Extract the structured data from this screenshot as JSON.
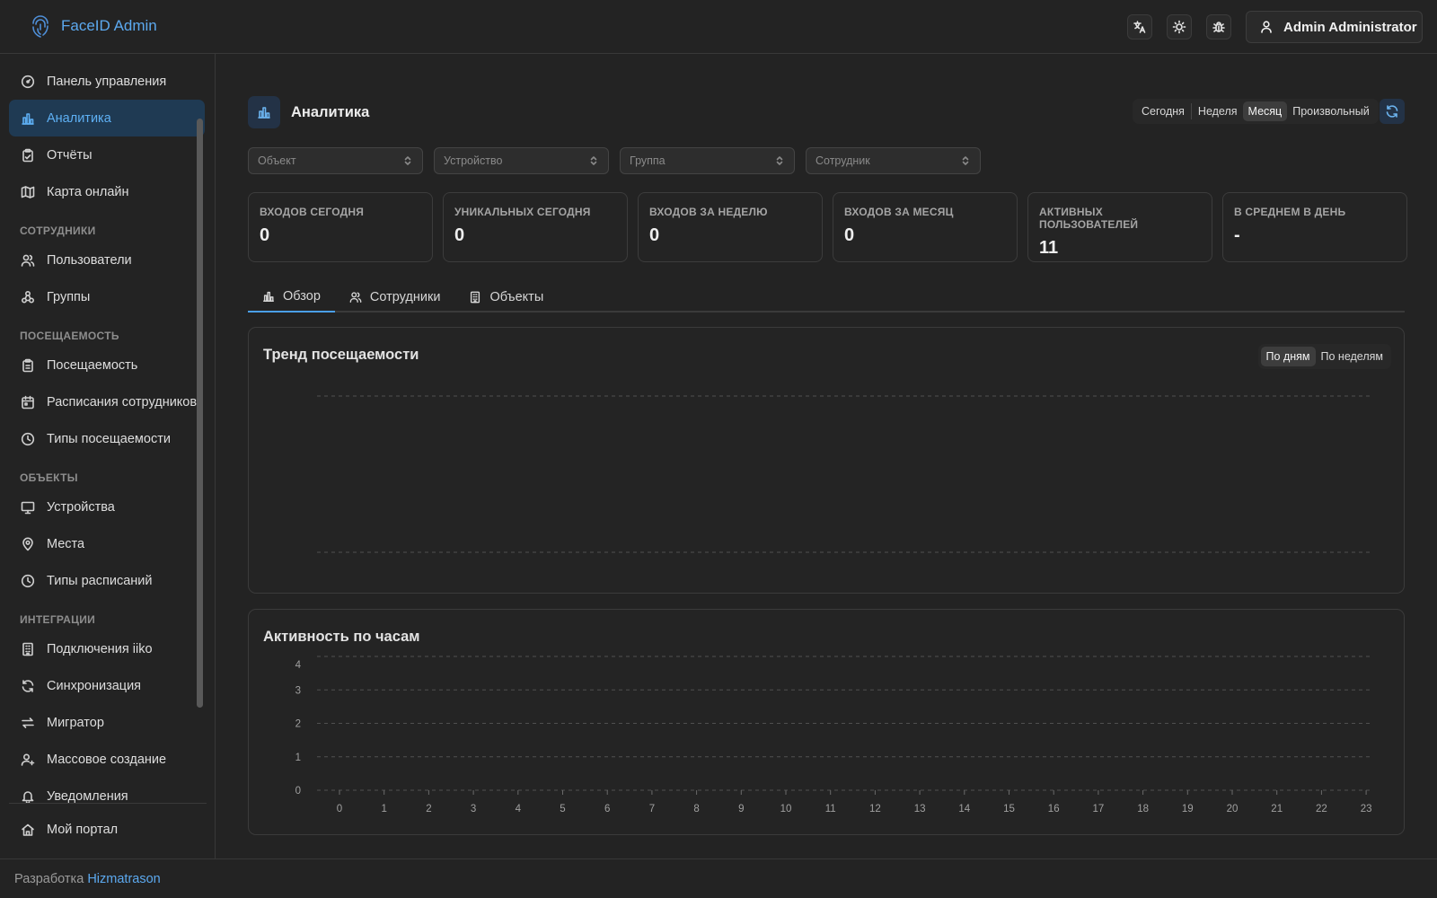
{
  "app": {
    "title": "FaceID Admin"
  },
  "header": {
    "user_name": "Admin Administrator"
  },
  "sidebar": {
    "items_top": [
      {
        "label": "Панель управления",
        "icon": "gauge-icon"
      },
      {
        "label": "Аналитика",
        "icon": "bar-chart-icon",
        "active": true
      },
      {
        "label": "Отчёты",
        "icon": "clipboard-icon"
      },
      {
        "label": "Карта онлайн",
        "icon": "map-icon"
      }
    ],
    "sections": [
      {
        "title": "СОТРУДНИКИ",
        "items": [
          {
            "label": "Пользователи",
            "icon": "users-icon"
          },
          {
            "label": "Группы",
            "icon": "groups-icon"
          }
        ]
      },
      {
        "title": "ПОСЕЩАЕМОСТЬ",
        "items": [
          {
            "label": "Посещаемость",
            "icon": "clipboard-list-icon"
          },
          {
            "label": "Расписания сотрудников",
            "icon": "calendar-icon"
          },
          {
            "label": "Типы посещаемости",
            "icon": "clock-icon"
          }
        ]
      },
      {
        "title": "ОБЪЕКТЫ",
        "items": [
          {
            "label": "Устройства",
            "icon": "monitor-icon"
          },
          {
            "label": "Места",
            "icon": "map-pin-icon"
          },
          {
            "label": "Типы расписаний",
            "icon": "clock-icon"
          }
        ]
      },
      {
        "title": "ИНТЕГРАЦИИ",
        "items": [
          {
            "label": "Подключения iiko",
            "icon": "building-icon"
          },
          {
            "label": "Синхронизация",
            "icon": "refresh-icon"
          },
          {
            "label": "Мигратор",
            "icon": "arrows-icon"
          },
          {
            "label": "Массовое создание",
            "icon": "user-plus-icon"
          },
          {
            "label": "Уведомления",
            "icon": "bell-icon"
          }
        ]
      }
    ],
    "bottom_item": {
      "label": "Мой портал",
      "icon": "home-icon"
    }
  },
  "footer": {
    "prefix": "Разработка",
    "link": "Hizmatrason"
  },
  "main": {
    "title": "Аналитика",
    "periods": [
      "Сегодня",
      "Неделя",
      "Месяц",
      "Произвольный"
    ],
    "selected_period": "Месяц",
    "filters": [
      "Объект",
      "Устройство",
      "Группа",
      "Сотрудник"
    ],
    "stats": [
      {
        "label": "ВХОДОВ СЕГОДНЯ",
        "value": "0"
      },
      {
        "label": "УНИКАЛЬНЫХ СЕГОДНЯ",
        "value": "0"
      },
      {
        "label": "ВХОДОВ ЗА НЕДЕЛЮ",
        "value": "0"
      },
      {
        "label": "ВХОДОВ ЗА МЕСЯЦ",
        "value": "0"
      },
      {
        "label": "АКТИВНЫХ ПОЛЬЗОВАТЕЛЕЙ",
        "value": "11"
      },
      {
        "label": "В СРЕДНЕМ В ДЕНЬ",
        "value": "-"
      }
    ],
    "tabs": [
      {
        "label": "Обзор",
        "icon": "bar-chart-icon",
        "active": true
      },
      {
        "label": "Сотрудники",
        "icon": "users-icon"
      },
      {
        "label": "Объекты",
        "icon": "building-icon"
      }
    ],
    "trend": {
      "title": "Тренд посещаемости",
      "modes": [
        "По дням",
        "По неделям"
      ],
      "selected_mode": "По дням"
    },
    "hourly": {
      "title": "Активность по часам"
    }
  },
  "colors": {
    "accent": "#5ca9ef",
    "background": "#232323",
    "card": "#242424",
    "active_nav_bg": "#1f3a53"
  },
  "chart_data": [
    {
      "type": "line",
      "title": "Тренд посещаемости",
      "series": [],
      "grid": true
    },
    {
      "type": "bar",
      "title": "Активность по часам",
      "categories": [
        "0",
        "1",
        "2",
        "3",
        "4",
        "5",
        "6",
        "7",
        "8",
        "9",
        "10",
        "11",
        "12",
        "13",
        "14",
        "15",
        "16",
        "17",
        "18",
        "19",
        "20",
        "21",
        "22",
        "23"
      ],
      "values": [
        0,
        0,
        0,
        0,
        0,
        0,
        0,
        0,
        0,
        0,
        0,
        0,
        0,
        0,
        0,
        0,
        0,
        0,
        0,
        0,
        0,
        0,
        0,
        0
      ],
      "yticks": [
        0,
        1,
        2,
        3,
        4
      ],
      "ylim": [
        0,
        4
      ],
      "grid": true
    }
  ]
}
